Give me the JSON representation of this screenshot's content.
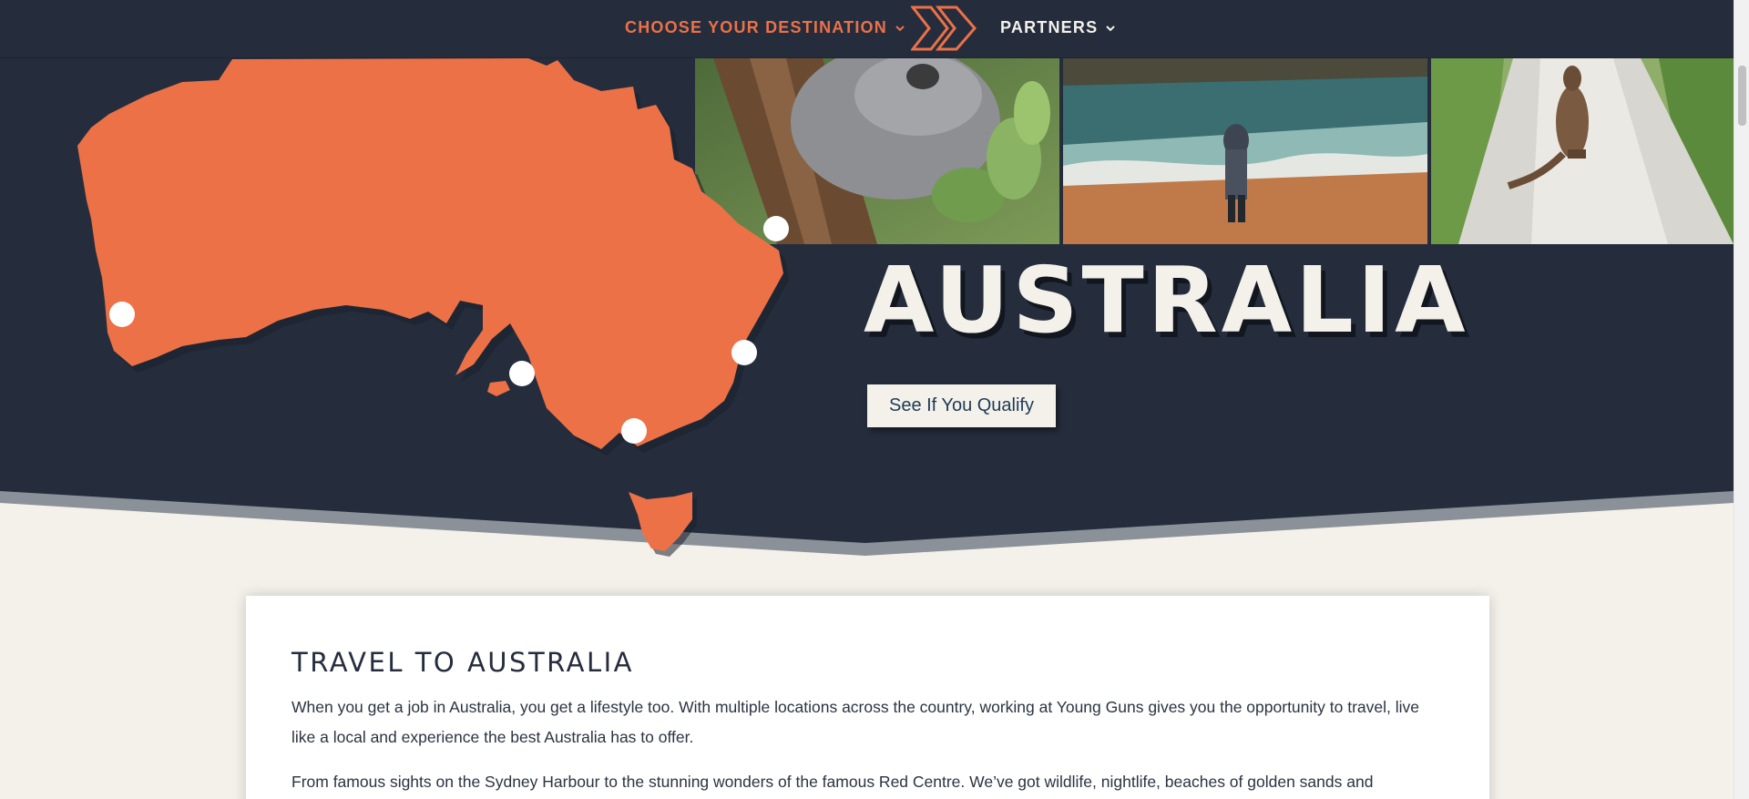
{
  "nav": {
    "destination_label": "CHOOSE YOUR DESTINATION",
    "partners_label": "PARTNERS"
  },
  "hero": {
    "title": "AUSTRALIA",
    "cta_label": "See If You Qualify",
    "photos": [
      "koala-photo",
      "beach-photo",
      "kangaroo-photo"
    ]
  },
  "content": {
    "heading": "TRAVEL TO AUSTRALIA",
    "paragraph_1": "When you get a job in Australia, you get a lifestyle too. With multiple locations across the country, working at Young Guns gives you the opportunity to travel, live like a local and experience the best Australia has to offer.",
    "paragraph_2": "From famous sights on the Sydney Harbour to the stunning wonders of the famous Red Centre. We’ve got wildlife, nightlife, beaches of golden sands and"
  },
  "colors": {
    "navy": "#252d3d",
    "orange": "#ec7147",
    "cream": "#f3f1ea"
  },
  "icons": {
    "logo": "double-chevron-logo",
    "dropdown": "chevron-down-icon"
  }
}
